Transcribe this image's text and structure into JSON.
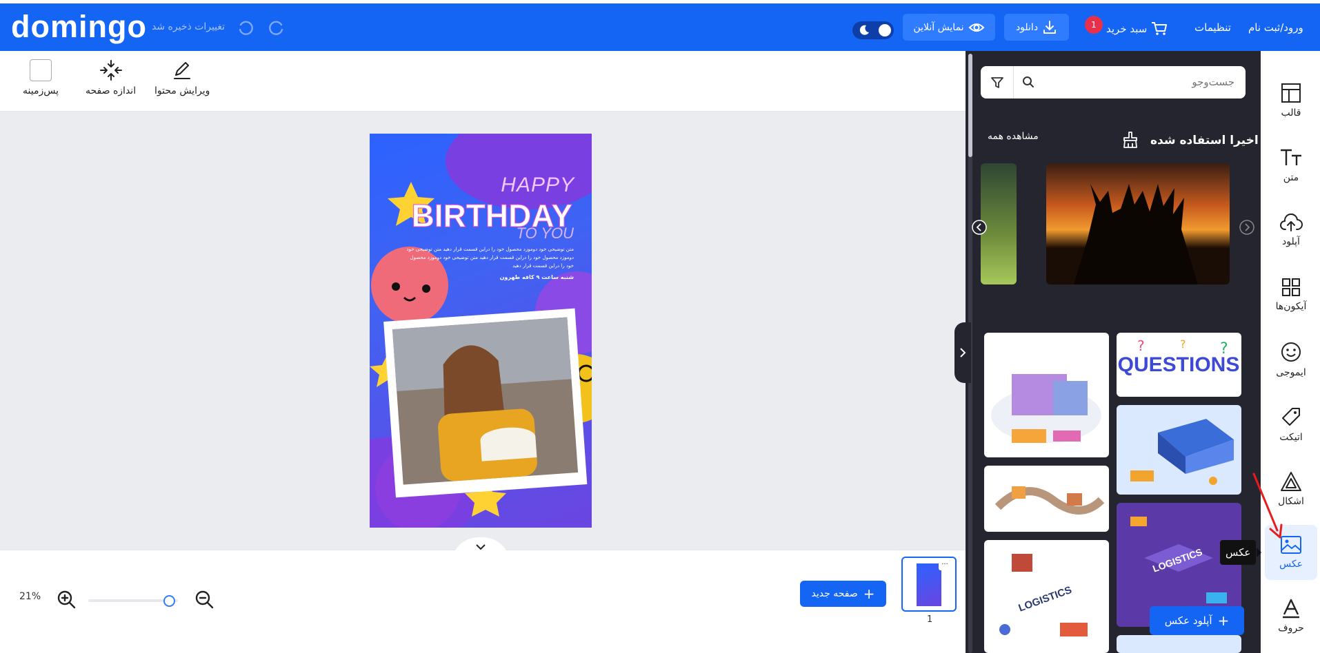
{
  "header": {
    "logo": "domingo",
    "saved_status": "تغییرات ذخیره شد",
    "undo_icon": "undo-icon",
    "redo_icon": "redo-icon",
    "theme_toggle_icon": "moon-icon",
    "preview_label": "نمایش آنلاین",
    "download_label": "دانلود",
    "cart_label": "سبد خرید",
    "cart_count": "1",
    "settings_label": "تنظیمات",
    "login_label": "ورود/ثبت نام"
  },
  "toolbar": {
    "background_label": "پس‌زمینه",
    "page_size_label": "اندازه صفحه",
    "edit_content_label": "ویرایش محتوا"
  },
  "design": {
    "happy": "HAPPY",
    "birthday": "BIRTHDAY",
    "to_you": "TO YOU",
    "desc_lines": [
      "متن توضیحی خود دوموزد محصول خود را دراین قسمت قرار دهید متن توضیحی خود",
      "دوموزد محصول خود را دراین قسمت قرار دهید متن توضیحی خود دوموزد محصول",
      "خود را دراین قسمت قرار دهید"
    ],
    "date_line": "شنبه ساعت ۹ کافه طهرون"
  },
  "bottom": {
    "zoom_percent": "21%",
    "zoom_level": 0.9,
    "new_page_label": "صفحه جدید",
    "page_number": "1"
  },
  "panel": {
    "search_placeholder": "جست‌وجو",
    "recent_title": "اخیرا استفاده شده",
    "see_all_label": "مشاهده همه",
    "upload_photo_label": "آپلود عکس"
  },
  "rail": {
    "items": [
      {
        "label": "قالب",
        "icon": "template-icon"
      },
      {
        "label": "متن",
        "icon": "text-icon"
      },
      {
        "label": "آپلود",
        "icon": "cloud-upload-icon"
      },
      {
        "label": "آیکون‌ها",
        "icon": "grid-icon"
      },
      {
        "label": "ایموجی",
        "icon": "emoji-icon"
      },
      {
        "label": "اتیکت",
        "icon": "tag-icon"
      },
      {
        "label": "اشکال",
        "icon": "shapes-icon"
      },
      {
        "label": "عکس",
        "icon": "image-icon"
      },
      {
        "label": "حروف",
        "icon": "letters-icon"
      }
    ],
    "active": "عکس",
    "tooltip": "عکس"
  },
  "colors": {
    "brand_blue": "#1565f5",
    "panel_dark": "#24252f",
    "canvas_bg": "#ebecf0"
  }
}
